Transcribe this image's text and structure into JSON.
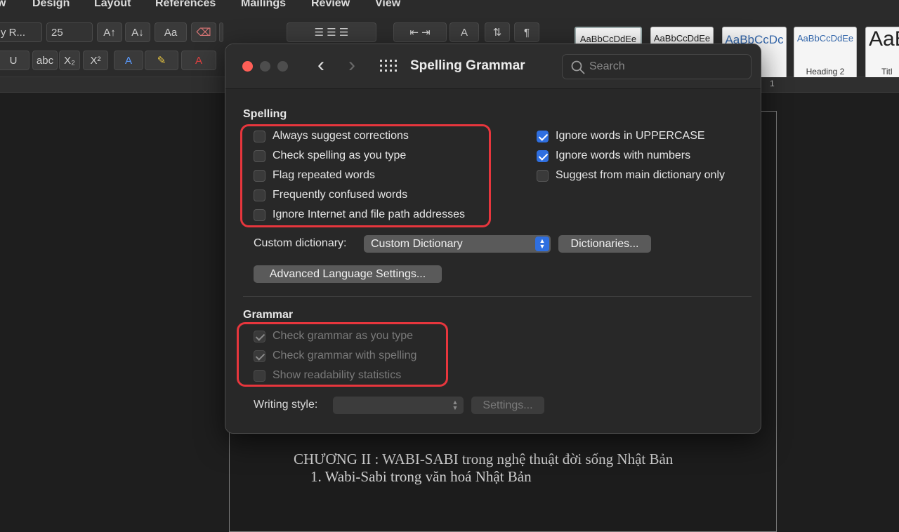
{
  "ribbon": {
    "tabs": [
      "w",
      "Design",
      "Layout",
      "References",
      "Mailings",
      "Review",
      "View"
    ],
    "font_name": "y R...",
    "font_size": "25",
    "styles": [
      {
        "sample": "AaBbCcDdEe",
        "name": ""
      },
      {
        "sample": "AaBbCcDdEe",
        "name": ""
      },
      {
        "sample": "AaBbCcDc",
        "name": "g 1"
      },
      {
        "sample": "AaBbCcDdEe",
        "name": "Heading 2"
      },
      {
        "sample": "AaB",
        "name": "Titl"
      }
    ],
    "ruler_mark": "1"
  },
  "window": {
    "title": "Spelling  Grammar",
    "search_placeholder": "Search"
  },
  "spelling": {
    "title": "Spelling",
    "left_options": [
      {
        "label": "Always suggest corrections",
        "checked": false
      },
      {
        "label": "Check spelling as you type",
        "checked": false
      },
      {
        "label": "Flag repeated words",
        "checked": false
      },
      {
        "label": "Frequently confused words",
        "checked": false
      },
      {
        "label": "Ignore Internet and file path addresses",
        "checked": false
      }
    ],
    "right_options": [
      {
        "label": "Ignore words in UPPERCASE",
        "checked": true
      },
      {
        "label": "Ignore words with numbers",
        "checked": true
      },
      {
        "label": "Suggest from main dictionary only",
        "checked": false
      }
    ],
    "custom_dictionary_label": "Custom dictionary:",
    "custom_dictionary_value": "Custom Dictionary",
    "dictionaries_button": "Dictionaries...",
    "advanced_button": "Advanced Language Settings..."
  },
  "grammar": {
    "title": "Grammar",
    "options": [
      {
        "label": "Check grammar as you type",
        "checked": true
      },
      {
        "label": "Check grammar with spelling",
        "checked": true
      },
      {
        "label": "Show readability statistics",
        "checked": false
      }
    ],
    "writing_style_label": "Writing style:",
    "writing_style_value": "",
    "settings_button": "Settings..."
  },
  "document": {
    "line1": "CHƯƠNG II : WABI-SABI trong nghệ thuật đời sống Nhật Bản",
    "line2": "1. Wabi-Sabi trong văn hoá Nhật Bản"
  },
  "colors": {
    "accent": "#2f6fe0",
    "highlight_box": "#e7363d",
    "close_light": "#fe5f57"
  }
}
